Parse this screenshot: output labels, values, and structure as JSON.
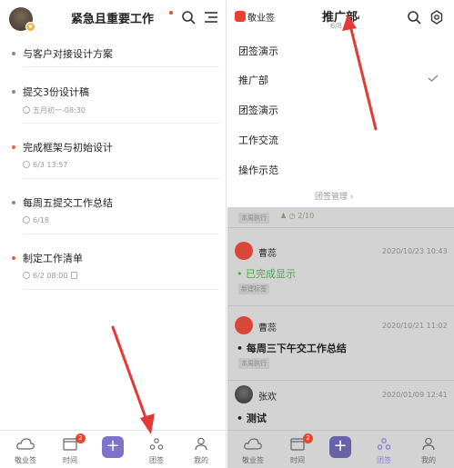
{
  "left": {
    "title": "紧急且重要工作",
    "tasks": [
      {
        "name": "与客户对接设计方案",
        "meta": "",
        "dot": "gray"
      },
      {
        "name": "提交3份设计稿",
        "meta": "五月初一-08:30",
        "dot": "gray"
      },
      {
        "name": "完成框架与初始设计",
        "meta": "6/3 13:57",
        "dot": "red"
      },
      {
        "name": "每周五提交工作总结",
        "meta": "6/18",
        "dot": "gray"
      },
      {
        "name": "制定工作清单",
        "meta": "6/2 08:00",
        "dot": "red"
      }
    ],
    "tabs": {
      "home": "敬业签",
      "time": "时间",
      "time_badge": "2",
      "group": "团签",
      "mine": "我的"
    }
  },
  "right": {
    "logo_text": "敬业签",
    "group_title": "推广部",
    "group_count": "6/8",
    "dropdown": {
      "items": [
        "团签演示",
        "推广部",
        "团签演示",
        "工作交流",
        "操作示范"
      ],
      "selected_index": 1,
      "manage_label": "团签管理"
    },
    "feed": {
      "top_meta": "2/10",
      "top_tag": "本周执行",
      "entries": [
        {
          "name": "曹蕊",
          "time": "2020/10/23 10:43",
          "text": "已完成显示",
          "tag": "新建标签",
          "green": true
        },
        {
          "name": "曹蕊",
          "time": "2020/10/21 11:02",
          "text": "每周三下午交工作总结",
          "tag": "本周执行",
          "green": false
        },
        {
          "name": "张欢",
          "time": "2020/01/09 12:41",
          "text": "测试",
          "tag": "",
          "green": false
        }
      ]
    },
    "tabs": {
      "home": "敬业签",
      "time": "时间",
      "time_badge": "2",
      "group": "团签",
      "mine": "我的"
    }
  },
  "colors": {
    "accent": "#7d72cc",
    "badge": "#e4472f",
    "arrow": "#e53935",
    "brand": "#e6422e"
  }
}
